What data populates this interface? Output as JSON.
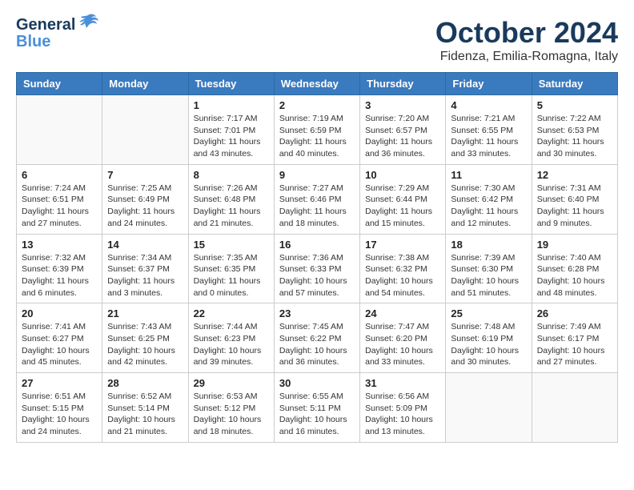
{
  "logo": {
    "general": "General",
    "blue": "Blue"
  },
  "title": "October 2024",
  "location": "Fidenza, Emilia-Romagna, Italy",
  "days_of_week": [
    "Sunday",
    "Monday",
    "Tuesday",
    "Wednesday",
    "Thursday",
    "Friday",
    "Saturday"
  ],
  "weeks": [
    [
      {
        "day": "",
        "info": ""
      },
      {
        "day": "",
        "info": ""
      },
      {
        "day": "1",
        "info": "Sunrise: 7:17 AM\nSunset: 7:01 PM\nDaylight: 11 hours and 43 minutes."
      },
      {
        "day": "2",
        "info": "Sunrise: 7:19 AM\nSunset: 6:59 PM\nDaylight: 11 hours and 40 minutes."
      },
      {
        "day": "3",
        "info": "Sunrise: 7:20 AM\nSunset: 6:57 PM\nDaylight: 11 hours and 36 minutes."
      },
      {
        "day": "4",
        "info": "Sunrise: 7:21 AM\nSunset: 6:55 PM\nDaylight: 11 hours and 33 minutes."
      },
      {
        "day": "5",
        "info": "Sunrise: 7:22 AM\nSunset: 6:53 PM\nDaylight: 11 hours and 30 minutes."
      }
    ],
    [
      {
        "day": "6",
        "info": "Sunrise: 7:24 AM\nSunset: 6:51 PM\nDaylight: 11 hours and 27 minutes."
      },
      {
        "day": "7",
        "info": "Sunrise: 7:25 AM\nSunset: 6:49 PM\nDaylight: 11 hours and 24 minutes."
      },
      {
        "day": "8",
        "info": "Sunrise: 7:26 AM\nSunset: 6:48 PM\nDaylight: 11 hours and 21 minutes."
      },
      {
        "day": "9",
        "info": "Sunrise: 7:27 AM\nSunset: 6:46 PM\nDaylight: 11 hours and 18 minutes."
      },
      {
        "day": "10",
        "info": "Sunrise: 7:29 AM\nSunset: 6:44 PM\nDaylight: 11 hours and 15 minutes."
      },
      {
        "day": "11",
        "info": "Sunrise: 7:30 AM\nSunset: 6:42 PM\nDaylight: 11 hours and 12 minutes."
      },
      {
        "day": "12",
        "info": "Sunrise: 7:31 AM\nSunset: 6:40 PM\nDaylight: 11 hours and 9 minutes."
      }
    ],
    [
      {
        "day": "13",
        "info": "Sunrise: 7:32 AM\nSunset: 6:39 PM\nDaylight: 11 hours and 6 minutes."
      },
      {
        "day": "14",
        "info": "Sunrise: 7:34 AM\nSunset: 6:37 PM\nDaylight: 11 hours and 3 minutes."
      },
      {
        "day": "15",
        "info": "Sunrise: 7:35 AM\nSunset: 6:35 PM\nDaylight: 11 hours and 0 minutes."
      },
      {
        "day": "16",
        "info": "Sunrise: 7:36 AM\nSunset: 6:33 PM\nDaylight: 10 hours and 57 minutes."
      },
      {
        "day": "17",
        "info": "Sunrise: 7:38 AM\nSunset: 6:32 PM\nDaylight: 10 hours and 54 minutes."
      },
      {
        "day": "18",
        "info": "Sunrise: 7:39 AM\nSunset: 6:30 PM\nDaylight: 10 hours and 51 minutes."
      },
      {
        "day": "19",
        "info": "Sunrise: 7:40 AM\nSunset: 6:28 PM\nDaylight: 10 hours and 48 minutes."
      }
    ],
    [
      {
        "day": "20",
        "info": "Sunrise: 7:41 AM\nSunset: 6:27 PM\nDaylight: 10 hours and 45 minutes."
      },
      {
        "day": "21",
        "info": "Sunrise: 7:43 AM\nSunset: 6:25 PM\nDaylight: 10 hours and 42 minutes."
      },
      {
        "day": "22",
        "info": "Sunrise: 7:44 AM\nSunset: 6:23 PM\nDaylight: 10 hours and 39 minutes."
      },
      {
        "day": "23",
        "info": "Sunrise: 7:45 AM\nSunset: 6:22 PM\nDaylight: 10 hours and 36 minutes."
      },
      {
        "day": "24",
        "info": "Sunrise: 7:47 AM\nSunset: 6:20 PM\nDaylight: 10 hours and 33 minutes."
      },
      {
        "day": "25",
        "info": "Sunrise: 7:48 AM\nSunset: 6:19 PM\nDaylight: 10 hours and 30 minutes."
      },
      {
        "day": "26",
        "info": "Sunrise: 7:49 AM\nSunset: 6:17 PM\nDaylight: 10 hours and 27 minutes."
      }
    ],
    [
      {
        "day": "27",
        "info": "Sunrise: 6:51 AM\nSunset: 5:15 PM\nDaylight: 10 hours and 24 minutes."
      },
      {
        "day": "28",
        "info": "Sunrise: 6:52 AM\nSunset: 5:14 PM\nDaylight: 10 hours and 21 minutes."
      },
      {
        "day": "29",
        "info": "Sunrise: 6:53 AM\nSunset: 5:12 PM\nDaylight: 10 hours and 18 minutes."
      },
      {
        "day": "30",
        "info": "Sunrise: 6:55 AM\nSunset: 5:11 PM\nDaylight: 10 hours and 16 minutes."
      },
      {
        "day": "31",
        "info": "Sunrise: 6:56 AM\nSunset: 5:09 PM\nDaylight: 10 hours and 13 minutes."
      },
      {
        "day": "",
        "info": ""
      },
      {
        "day": "",
        "info": ""
      }
    ]
  ]
}
